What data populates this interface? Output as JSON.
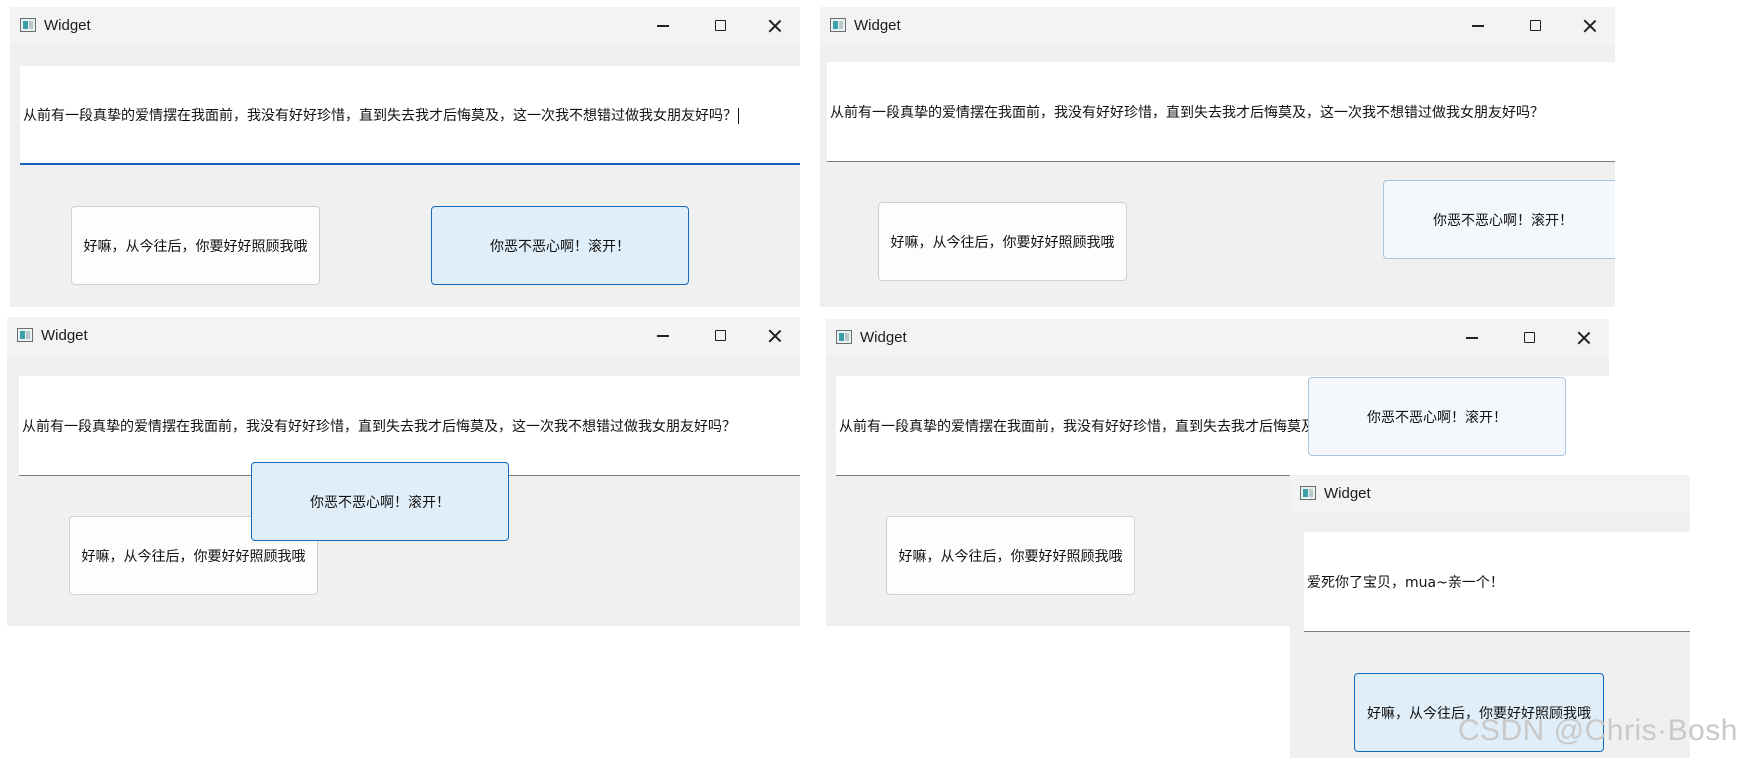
{
  "windows": [
    {
      "title": "Widget",
      "text": "从前有一段真挚的爱情摆在我面前，我没有好好珍惜，直到失去我才后悔莫及，这一次我不想错过做我女朋友好吗？",
      "accept_label": "好嘛，从今往后，你要好好照顾我哦",
      "reject_label": "你恶不恶心啊！滚开！"
    },
    {
      "title": "Widget",
      "text": "从前有一段真挚的爱情摆在我面前，我没有好好珍惜，直到失去我才后悔莫及，这一次我不想错过做我女朋友好吗？",
      "accept_label": "好嘛，从今往后，你要好好照顾我哦",
      "reject_label": "你恶不恶心啊！滚开！"
    },
    {
      "title": "Widget",
      "text": "从前有一段真挚的爱情摆在我面前，我没有好好珍惜，直到失去我才后悔莫及，这一次我不想错过做我女朋友好吗？",
      "accept_label": "好嘛，从今往后，你要好好照顾我哦",
      "reject_label": "你恶不恶心啊！滚开！"
    },
    {
      "title": "Widget",
      "text": "从前有一段真挚的爱情摆在我面前，我没有好好珍惜，直到失去我才后悔莫及，这一次我不想错过做我女朋友好吗？",
      "accept_label": "好嘛，从今往后，你要好好照顾我哦",
      "reject_label": "你恶不恶心啊！滚开！"
    },
    {
      "title": "Widget",
      "text": "爱死你了宝贝，mua~亲一个！",
      "accept_label": "好嘛，从今往后，你要好好照顾我哦"
    }
  ],
  "watermark": "CSDN @Chris·Bosh"
}
